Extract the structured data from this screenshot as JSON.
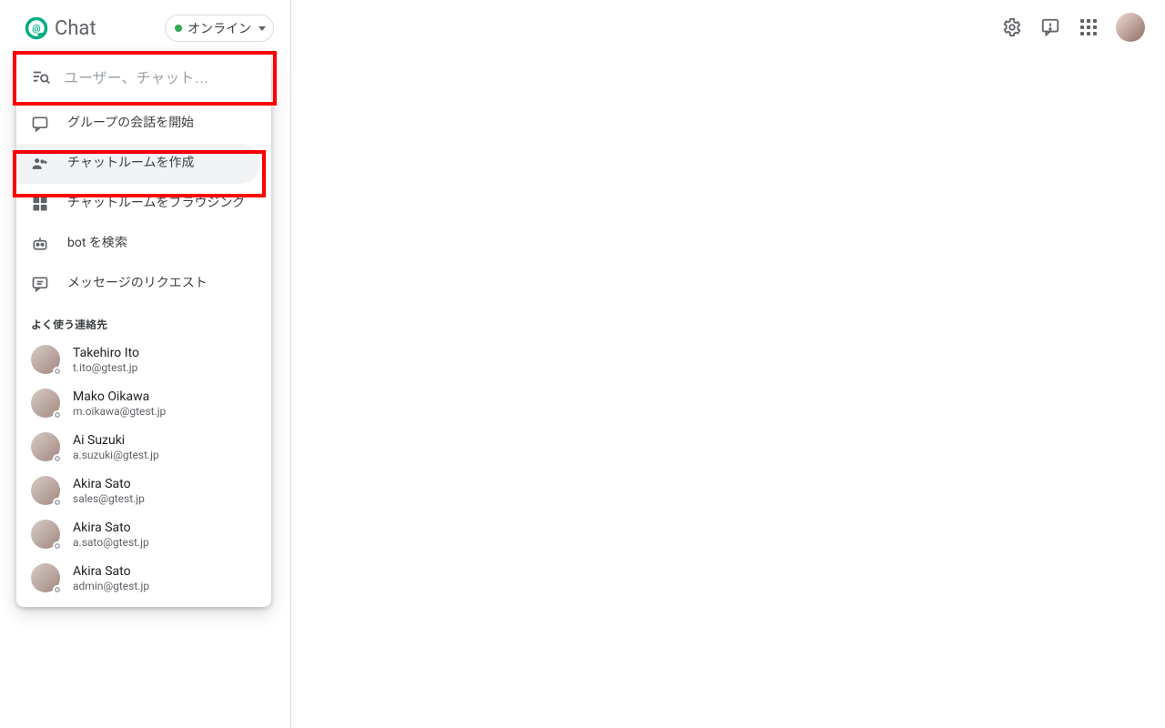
{
  "app": {
    "title": "Chat"
  },
  "status": {
    "label": "オンライン"
  },
  "search": {
    "placeholder": "ユーザー、チャット…"
  },
  "menu": {
    "start_group": "グループの会話を開始",
    "create_room": "チャットルームを作成",
    "browse_rooms": "チャットルームをブラウジング",
    "search_bot": "bot を検索",
    "message_requests": "メッセージのリクエスト"
  },
  "contacts": {
    "heading": "よく使う連絡先",
    "items": [
      {
        "name": "Takehiro Ito",
        "email": "t.ito@gtest.jp"
      },
      {
        "name": "Mako Oikawa",
        "email": "m.oikawa@gtest.jp"
      },
      {
        "name": "Ai Suzuki",
        "email": "a.suzuki@gtest.jp"
      },
      {
        "name": "Akira Sato",
        "email": "sales@gtest.jp"
      },
      {
        "name": "Akira Sato",
        "email": "a.sato@gtest.jp"
      },
      {
        "name": "Akira Sato",
        "email": "admin@gtest.jp"
      }
    ]
  }
}
